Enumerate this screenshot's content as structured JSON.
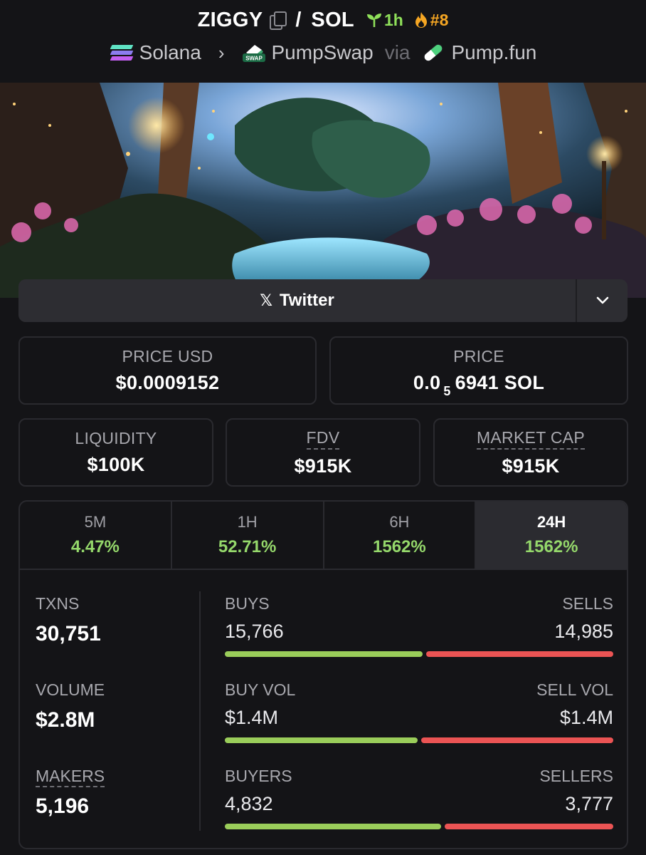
{
  "header": {
    "token": "ZIGGY",
    "quote": "SOL",
    "age": "1h",
    "rank": "#8",
    "chain": "Solana",
    "dex": "PumpSwap",
    "via": "via",
    "launchpad": "Pump.fun",
    "swap_badge": "SWAP"
  },
  "social": {
    "twitter_label": "Twitter"
  },
  "price_usd": {
    "label": "PRICE USD",
    "value": "$0.0009152"
  },
  "price_native": {
    "label": "PRICE",
    "prefix": "0.0",
    "subscript": "5",
    "suffix": "6941 SOL"
  },
  "liquidity": {
    "label": "LIQUIDITY",
    "value": "$100K"
  },
  "fdv": {
    "label": "FDV",
    "value": "$915K"
  },
  "market_cap": {
    "label": "MARKET CAP",
    "value": "$915K"
  },
  "timeframes": [
    {
      "label": "5M",
      "change": "4.47%"
    },
    {
      "label": "1H",
      "change": "52.71%"
    },
    {
      "label": "6H",
      "change": "1562%"
    },
    {
      "label": "24H",
      "change": "1562%"
    }
  ],
  "active_timeframe": "24H",
  "txns": {
    "label": "TXNS",
    "value": "30,751"
  },
  "volume": {
    "label": "VOLUME",
    "value": "$2.8M"
  },
  "makers": {
    "label": "MAKERS",
    "value": "5,196"
  },
  "buys": {
    "label": "BUYS",
    "value": "15,766"
  },
  "sells": {
    "label": "SELLS",
    "value": "14,985"
  },
  "buy_vol": {
    "label": "BUY VOL",
    "value": "$1.4M"
  },
  "sell_vol": {
    "label": "SELL VOL",
    "value": "$1.4M"
  },
  "buyers": {
    "label": "BUYERS",
    "value": "4,832"
  },
  "sellers": {
    "label": "SELLERS",
    "value": "3,777"
  },
  "ratios": {
    "txns_buy_fraction": 0.513,
    "vol_buy_fraction": 0.5,
    "makers_buy_fraction": 0.561
  },
  "colors": {
    "buy": "#9acd5a",
    "sell": "#eb5454",
    "positive": "#95d86b",
    "age": "#8fe05a",
    "rank": "#f5a623"
  }
}
